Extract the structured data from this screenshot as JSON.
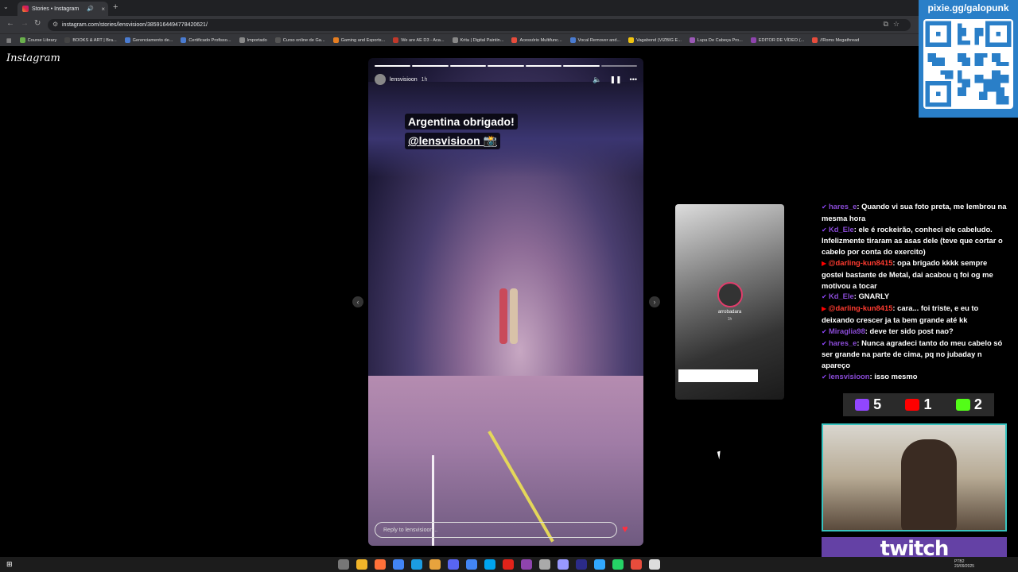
{
  "browser": {
    "tab_title": "Stories • Instagram",
    "url": "instagram.com/stories/lensvisioon/3859164494778420621/",
    "bookmarks": [
      "Course Library",
      "BOOKS & ART | Bra...",
      "Gerenciamento de...",
      "Certificado Profisso...",
      "Importado",
      "Curso online de Ga...",
      "Gaming and Esports...",
      "We are AE D3 - Aca...",
      "Krita | Digital Paintin...",
      "Acessório Multifunc...",
      "Vocal Remover and...",
      "Vagabond (VIZBIG E...",
      "Lupa De Cabeça Pro...",
      "EDITOR DE VÍDEO (...",
      "//Roms Megathread"
    ]
  },
  "instagram": {
    "logo": "Instagram",
    "story": {
      "username": "lensvisioon",
      "time": "1h",
      "caption_line1": "Argentina obrigado!",
      "caption_line2": "@lensvisioon 📸",
      "reply_placeholder": "Reply to lensvisioon...",
      "segments_total": 7,
      "segments_done": 6
    },
    "next_story": {
      "username": "arrobadara",
      "time": "1h"
    }
  },
  "stream_overlay": {
    "qr_url": "pixie.gg/galopunk",
    "chat": [
      {
        "user": "hares_e",
        "platform": "twitch",
        "text": "Quando vi sua foto preta, me lembrou na mesma hora"
      },
      {
        "user": "Kd_Ele",
        "platform": "twitch",
        "text": "ele é rockeirão, conheci ele cabeludo. Infelizmente tiraram as asas dele (teve que cortar o cabelo por conta do exercito)"
      },
      {
        "user": "@darling-kun8415",
        "platform": "youtube",
        "text": "opa brigado kkkk sempre gostei bastante de Metal, dai acabou q foi og me motivou a tocar"
      },
      {
        "user": "Kd_Ele",
        "platform": "twitch",
        "text": "GNARLY"
      },
      {
        "user": "@darling-kun8415",
        "platform": "youtube",
        "text": "cara... foi triste, e eu to deixando crescer ja ta bem grande até kk"
      },
      {
        "user": "Miraglia98",
        "platform": "twitch",
        "text": "deve ter sido post nao?"
      },
      {
        "user": "hares_e",
        "platform": "twitch",
        "text": "Nunca agradeci tanto do meu cabelo só ser grande na parte de cima, pq no jubaday n apareço"
      },
      {
        "user": "lensvisioon",
        "platform": "twitch",
        "text": "isso mesmo"
      }
    ],
    "viewer_counts": {
      "twitch": "5",
      "youtube": "1",
      "kick": "2"
    },
    "twitch_banner": "twitch"
  },
  "taskbar": {
    "tray_lang": "PTB2",
    "tray_date": "23/09/2025"
  },
  "colors": {
    "twitch": "#9146ff",
    "youtube": "#ff0000",
    "kick": "#53fc18",
    "qr_bg": "#2a7fc8",
    "webcam_border": "#38c4c0"
  }
}
